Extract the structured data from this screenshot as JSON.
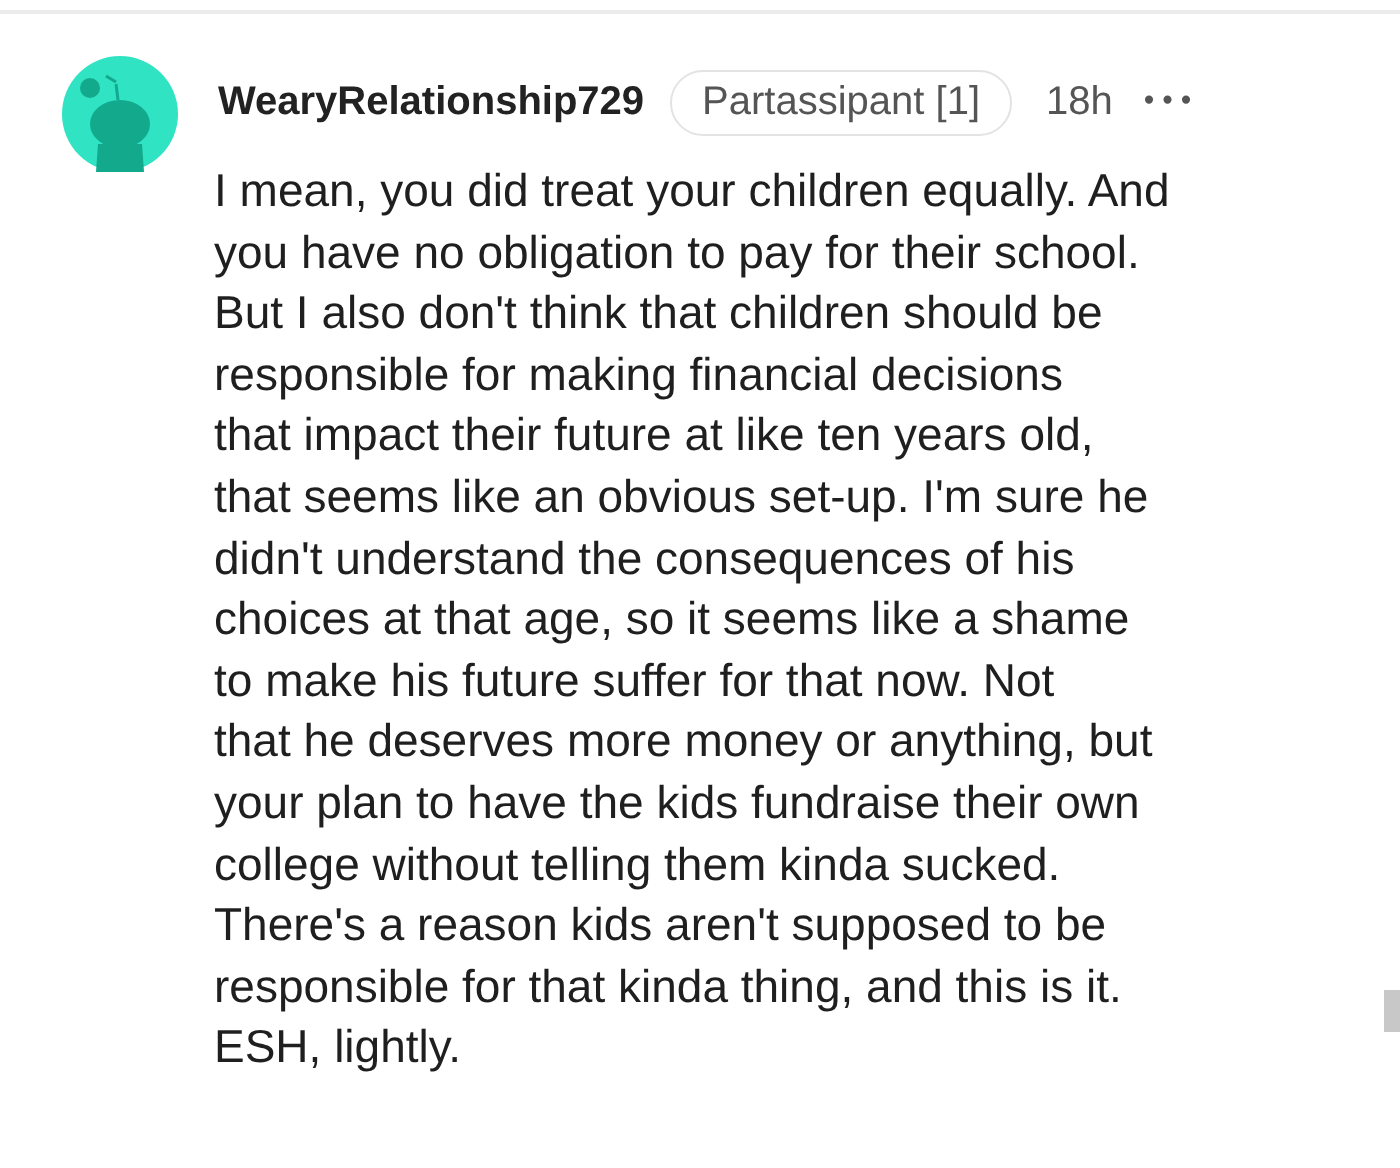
{
  "comment": {
    "username": "WearyRelationship729",
    "flair": "Partassipant [1]",
    "time": "18h",
    "menu": "•••",
    "body_lines": [
      "I mean, you did treat your children equally. And",
      "you have no obligation to pay for their school.",
      "But I also don't think that children should be",
      "responsible for making financial decisions",
      "that impact their future at like ten years old,",
      "that seems like an obvious set-up. I'm sure he",
      "didn't understand the consequences of his",
      "choices at that age, so it seems like a shame",
      "to make his future suffer for that now. Not",
      "that he deserves more money or anything, but",
      "your plan to have the kids fundraise their own",
      "college without telling them kinda sucked.",
      "There's a reason kids aren't supposed to be",
      "responsible for that kinda thing, and this is it.",
      "ESH, lightly."
    ]
  }
}
